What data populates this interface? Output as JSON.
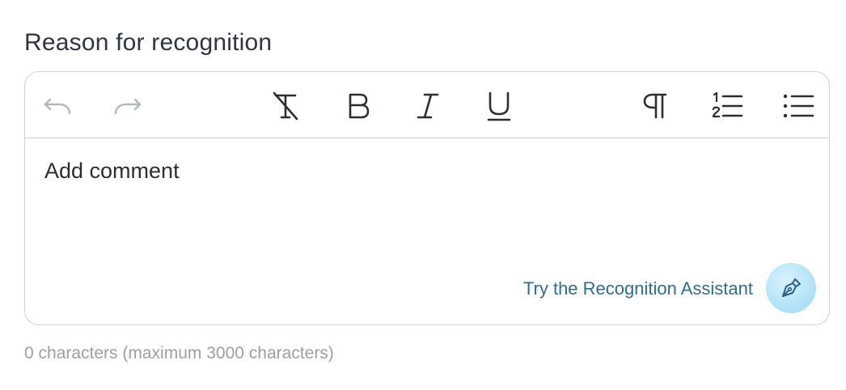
{
  "field": {
    "label": "Reason for recognition"
  },
  "toolbar": {
    "buttons": [
      {
        "name": "undo",
        "icon": "undo-icon"
      },
      {
        "name": "redo",
        "icon": "redo-icon"
      },
      {
        "name": "clear-formatting",
        "icon": "clear-formatting-icon"
      },
      {
        "name": "bold",
        "icon": "bold-icon"
      },
      {
        "name": "italic",
        "icon": "italic-icon"
      },
      {
        "name": "underline",
        "icon": "underline-icon"
      },
      {
        "name": "paragraph",
        "icon": "pilcrow-icon"
      },
      {
        "name": "ordered-list",
        "icon": "ordered-list-icon"
      },
      {
        "name": "bullet-list",
        "icon": "bullet-list-icon"
      }
    ]
  },
  "editor": {
    "placeholder": "Add comment"
  },
  "assistant": {
    "link_text": "Try the Recognition Assistant",
    "icon": "pen-nib-icon"
  },
  "counter": {
    "text": "0 characters (maximum 3000 characters)"
  },
  "colors": {
    "text": "#2f3542",
    "muted": "#9aa0a6",
    "link": "#2f6d91",
    "border": "#d3d3d3",
    "assistant_bg": "#b3e3f8",
    "disabled_icon": "#b5b8bb"
  }
}
